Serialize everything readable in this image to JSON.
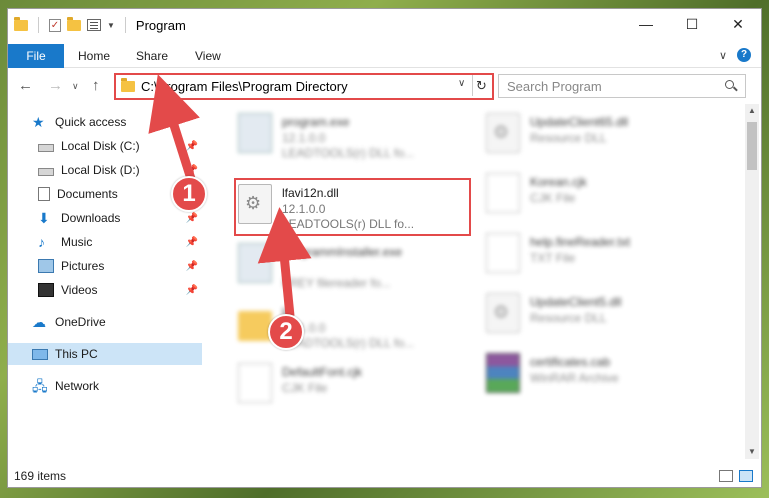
{
  "window": {
    "title": "Program",
    "controls": [
      "—",
      "☐",
      "✕"
    ]
  },
  "ribbon": {
    "tabs": [
      "File",
      "Home",
      "Share",
      "View"
    ]
  },
  "nav": {
    "address": "C:\\Program Files\\Program Directory",
    "search_placeholder": "Search Program"
  },
  "sidebar": {
    "items": [
      {
        "label": "Quick access",
        "icon": "star-icon"
      },
      {
        "label": "Local Disk (C:)",
        "icon": "disk-icon",
        "pinned": true
      },
      {
        "label": "Local Disk (D:)",
        "icon": "disk-icon",
        "pinned": true
      },
      {
        "label": "Documents",
        "icon": "documents-icon",
        "pinned": true
      },
      {
        "label": "Downloads",
        "icon": "downloads-icon",
        "pinned": true
      },
      {
        "label": "Music",
        "icon": "music-icon",
        "pinned": true
      },
      {
        "label": "Pictures",
        "icon": "pictures-icon",
        "pinned": true
      },
      {
        "label": "Videos",
        "icon": "videos-icon",
        "pinned": true
      },
      {
        "label": "OneDrive",
        "icon": "cloud-icon"
      },
      {
        "label": "This PC",
        "icon": "pc-icon",
        "selected": true
      },
      {
        "label": "Network",
        "icon": "network-icon"
      }
    ]
  },
  "files": {
    "left": [
      {
        "name": "program.exe",
        "version": "12.1.0.0",
        "desc": "LEADTOOLS(r) DLL fo...",
        "icon": "exe-icon",
        "blurred": true
      },
      {
        "name": "lfavi12n.dll",
        "version": "12.1.0.0",
        "desc": "LEADTOOLS(r) DLL fo...",
        "icon": "dll-icon",
        "blurred": false
      },
      {
        "name": "ProgrammInstaller.exe",
        "version": "",
        "desc": "FREY filereader fo...",
        "icon": "exe-icon",
        "blurred": true
      },
      {
        "name": "ld",
        "version": "12.1.0.0",
        "desc": "LEADTOOLS(r) DLL fo...",
        "icon": "folder-icon",
        "blurred": true
      },
      {
        "name": "DefaultFont.cjk",
        "version": "CJK File",
        "desc": "",
        "icon": "doc-icon",
        "blurred": true
      }
    ],
    "right": [
      {
        "name": "UpdateClient65.dll",
        "version": "Resource DLL",
        "desc": "",
        "icon": "dll-icon",
        "blurred": true
      },
      {
        "name": "Korean.cjk",
        "version": "CJK File",
        "desc": "",
        "icon": "doc-icon",
        "blurred": true
      },
      {
        "name": "help.fineReader.txt",
        "version": "TXT File",
        "desc": "",
        "icon": "doc-icon",
        "blurred": true
      },
      {
        "name": "UpdateClient5.dll",
        "version": "Resource DLL",
        "desc": "",
        "icon": "dll-icon",
        "blurred": true
      },
      {
        "name": "certificates.cab",
        "version": "WinRAR Archive",
        "desc": "",
        "icon": "rar-icon",
        "blurred": true
      }
    ]
  },
  "status": {
    "count": "169 items"
  },
  "annotations": {
    "badge1": "1",
    "badge2": "2"
  },
  "colors": {
    "accent": "#1979ca",
    "annotation": "#e34a4a",
    "selected": "#cce4f7"
  }
}
